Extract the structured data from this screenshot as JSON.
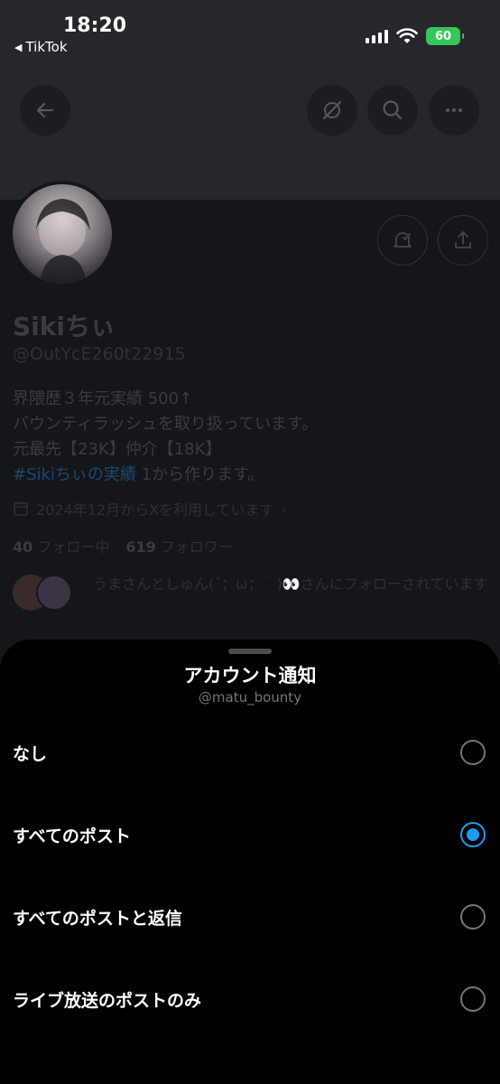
{
  "status_bar": {
    "time": "18:20",
    "back_app": "TikTok",
    "battery": "60"
  },
  "header": {
    "back_icon": "arrow-left-icon",
    "actions": [
      "grok-icon",
      "search-icon",
      "more-icon"
    ]
  },
  "profile": {
    "name": "Sikiちぃ",
    "handle": "@OutYcE260t22915",
    "bio_line1": "界隈歴３年元実績 500↑",
    "bio_line2": "バウンティラッシュを取り扱っています。",
    "bio_line3": "元最先【23K】仲介【18K】",
    "bio_hashtag": "#Sikiちぃの実績",
    "bio_line4_rest": " 1から作ります。",
    "joined": "2024年12月からXを利用しています",
    "following_count": "40",
    "following_label": "フォロー中",
    "followers_count": "619",
    "followers_label": "フォロワー",
    "followed_by": "うまさんとしゅん(´；ω；｀)👀さんにフォローされています"
  },
  "sheet": {
    "title": "アカウント通知",
    "subtitle": "@matu_bounty",
    "options": [
      {
        "label": "なし",
        "selected": false
      },
      {
        "label": "すべてのポスト",
        "selected": true
      },
      {
        "label": "すべてのポストと返信",
        "selected": false
      },
      {
        "label": "ライブ放送のポストのみ",
        "selected": false
      }
    ]
  },
  "colors": {
    "accent": "#1d9bf0",
    "sheet_bg": "#000000",
    "dimmed_bg": "#15161a"
  }
}
